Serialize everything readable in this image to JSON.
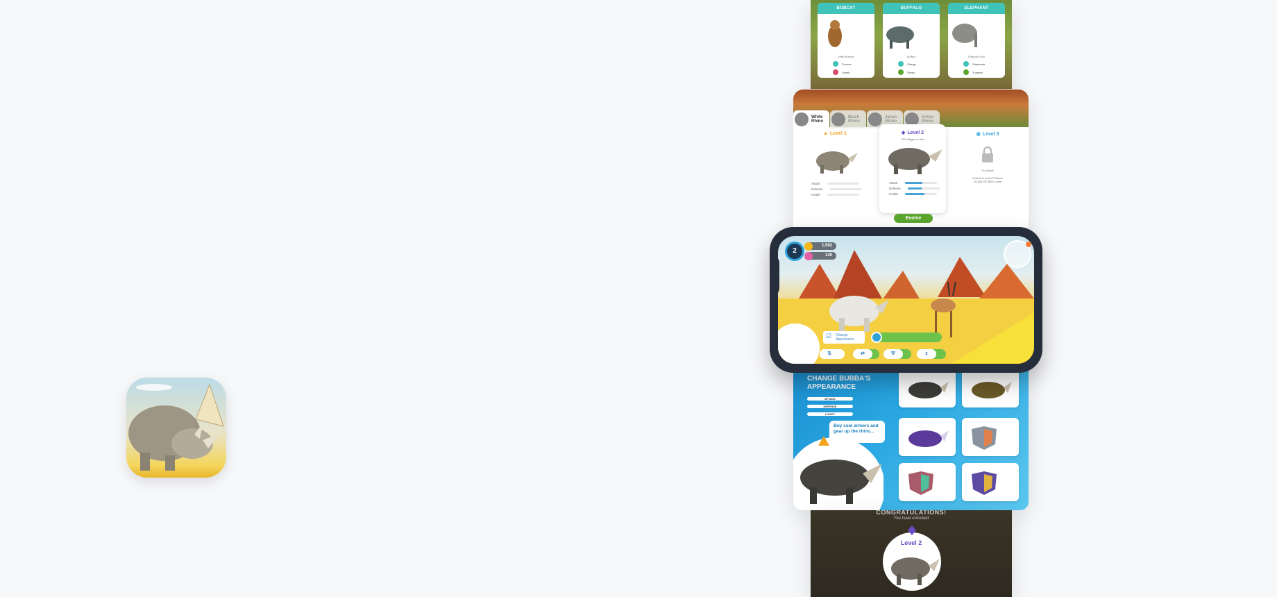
{
  "app_icon": {
    "name": "rhino-app-icon"
  },
  "animals_screen": {
    "cards": [
      {
        "name": "BOBCAT",
        "subtitle": "Male Bobcat",
        "traits": [
          "Pounce",
          "Sneak"
        ]
      },
      {
        "name": "BUFFALO",
        "subtitle": "Buffalo",
        "traits": [
          "Charge",
          "Stomp"
        ]
      },
      {
        "name": "ELEPHANT",
        "subtitle": "Elephant Bull",
        "traits": [
          "Stampede",
          "Trumpet"
        ]
      }
    ]
  },
  "levels_screen": {
    "tabs": [
      {
        "label": "White Rhino",
        "active": true
      },
      {
        "label": "Black Rhino",
        "active": false
      },
      {
        "label": "Javan Rhino",
        "active": false
      },
      {
        "label": "Indian Rhino",
        "active": false
      }
    ],
    "level1": {
      "title": "Level 1",
      "stats": [
        {
          "label": "Attack",
          "value": 0
        },
        {
          "label": "Defense",
          "value": 0
        },
        {
          "label": "Health",
          "value": 0
        }
      ]
    },
    "level2": {
      "title": "Level 2",
      "subtitle": "20% Bigger in size",
      "stats": [
        {
          "label": "Attack",
          "value": 0.55
        },
        {
          "label": "Defense",
          "value": 0.45
        },
        {
          "label": "Health",
          "value": 0.6
        }
      ]
    },
    "level3": {
      "title": "Level 3",
      "lock_text": "To Unlock",
      "requirement": "Evolve to Level 2 Reach 20,000 XP 3000 Coins"
    },
    "evolve_label": "Evolve"
  },
  "game_hud": {
    "level": "2",
    "coins": "1,592",
    "gems": "120",
    "change_appearance": "Change Appearance",
    "action_icons": [
      "⇅",
      "⇄",
      "⛨",
      "z"
    ]
  },
  "appearance_screen": {
    "title": "CHANGE BUBBA'S APPEARANCE",
    "stats": [
      "ATTACK",
      "DEFENSE",
      "LUCKY"
    ],
    "bubble": "Buy cool armors and gear up the rhino..."
  },
  "congrats_screen": {
    "title": "CONGRATULATIONS!",
    "subtitle": "You have unlocked",
    "level": "Level 2"
  },
  "colors": {
    "teal": "#3fc3b9",
    "green": "#6cc24a",
    "blue": "#2fa3d9",
    "purple": "#6a4bc4",
    "orange": "#f4a21b"
  }
}
